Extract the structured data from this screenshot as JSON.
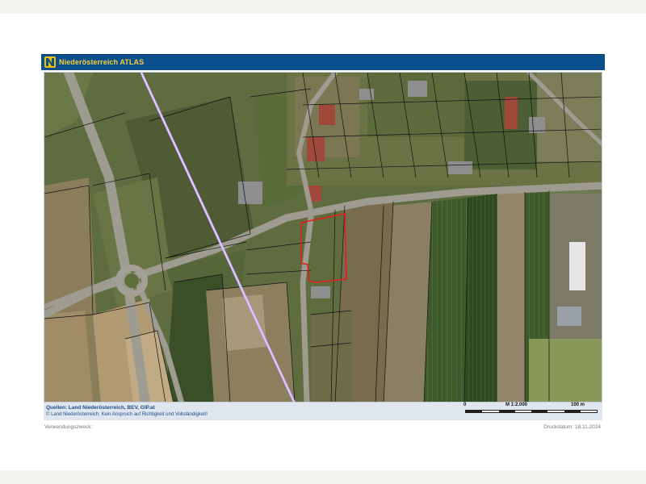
{
  "header": {
    "logo_letter": "N",
    "title": "Niederösterreich ATLAS",
    "color": "#0b4f8f",
    "title_color": "#f6d23a"
  },
  "map": {
    "type": "aerial orthophoto with cadastral parcel lines",
    "highlight_color": "#e0201e",
    "powerline_color": "#c9a8ff"
  },
  "footer": {
    "sources": "Quellen: Land Niederösterreich, BEV, GIP.at",
    "copyright": "© Land Niederösterreich: Kein Anspruch auf Richtigkeit und Vollständigkeit!",
    "scale_start": "0",
    "scale_ratio": "M 1:2.000",
    "scale_end": "100 m"
  },
  "meta": {
    "purpose_label": "Verwendungszweck:",
    "print_date": "Druckdatum: 18.11.2024"
  }
}
